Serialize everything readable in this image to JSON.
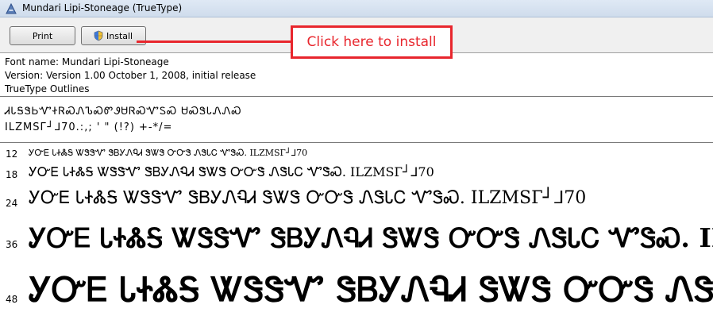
{
  "window": {
    "title": "Mundari Lipi-Stoneage (TrueType)",
    "icon": "font-viewer-icon"
  },
  "toolbar": {
    "print_label": "Print",
    "install_label": "Install",
    "install_icon": "uac-shield-icon"
  },
  "annotation": {
    "callout_text": "Click here to install",
    "color": "#e8262d"
  },
  "font_info": {
    "name_line": "Font name: Mundari Lipi-Stoneage",
    "version_line": "Version: Version 1.00 October 1, 2008, initial release",
    "type_line": "TrueType Outlines"
  },
  "charset": {
    "line1": "ᏗᏓᎦᏕᏏᏉᏐᏒᏍᏁᏖᏍᏛᏭᏌᏒᏍᏉᏚᏍ ᏌᏍᏕᏓᏁᏁᏍ",
    "line2": "ILZMSГ┘ᒧ70.:,; ' \" (!?) +-*/="
  },
  "samples": [
    {
      "size": "12",
      "text": "ᎩᏅᎬ ᏓᏐᏜᎦ ᏔᏕᏕᏉ ᏕᏴᎩᏁᏄᏗ ᏕᏔᏕ ᏅᏅᏕ ᏁᏕᏓᏟ ᏉᏕᏍ. ILZMSГ┘ᒧ70"
    },
    {
      "size": "18",
      "text": "ᎩᏅᎬ ᏓᏐᏜᎦ ᏔᏕᏕᏉ ᏕᏴᎩᏁᏄᏗ ᏕᏔᏕ ᏅᏅᏕ ᏁᏕᏓᏟ ᏉᏕᏍ. ILZMSГ┘ᒧ70"
    },
    {
      "size": "24",
      "text": "ᎩᏅᎬ ᏓᏐᏜᎦ ᏔᏕᏕᏉ ᏕᏴᎩᏁᏄᏗ ᏕᏔᏕ ᏅᏅᏕ ᏁᏕᏓᏟ ᏉᏕᏍ. ILZMSГ┘ᒧ70"
    },
    {
      "size": "36",
      "text": "ᎩᏅᎬ ᏓᏐᏜᎦ ᏔᏕᏕᏉ ᏕᏴᎩᏁᏄᏗ ᏕᏔᏕ ᏅᏅᏕ ᏁᏕᏓᏟ ᏉᏕᏍ. ILZ"
    },
    {
      "size": "48",
      "text": "ᎩᏅᎬ ᏓᏐᏜᎦ ᏔᏕᏕᏉ ᏕᏴᎩᏁᏄᏗ ᏕᏔᏕ ᏅᏅᏕ ᏁᏕ"
    }
  ]
}
